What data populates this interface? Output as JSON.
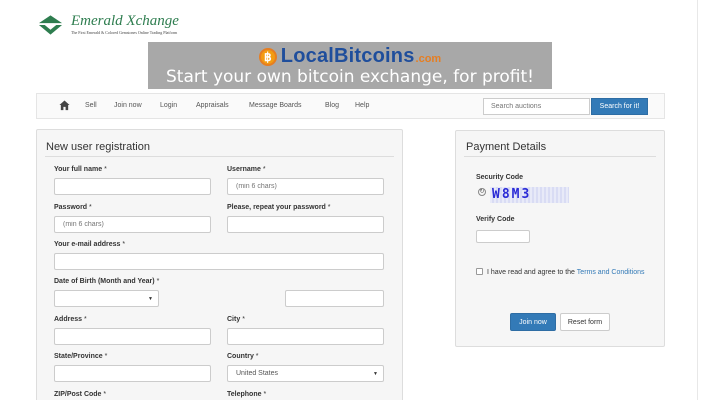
{
  "logo": {
    "title": "Emerald Xchange",
    "tagline": "The First Emerald & Colored Gemstones Online Trading Platform"
  },
  "banner": {
    "brand": "LocalBitcoins",
    "brand_suffix": ".com",
    "coin_symbol": "฿",
    "tagline": "Start your own bitcoin exchange, for profit!"
  },
  "nav": {
    "home_icon": "home-icon",
    "links": [
      "Sell",
      "Join now",
      "Login",
      "Appraisals",
      "Message Boards",
      "Blog",
      "Help"
    ],
    "search_placeholder": "Search auctions",
    "search_button": "Search for it!"
  },
  "registration": {
    "title": "New user registration",
    "full_name_label": "Your full name",
    "username_label": "Username",
    "username_placeholder": "(min 6 chars)",
    "password_label": "Password",
    "password_placeholder": "(min 6 chars)",
    "repeat_password_label": "Please, repeat your password",
    "email_label": "Your e-mail address",
    "dob_label": "Date of Birth (Month and Year)",
    "address_label": "Address",
    "city_label": "City",
    "state_label": "State/Province",
    "country_label": "Country",
    "country_value": "United States",
    "zip_label": "ZIP/Post Code",
    "telephone_label": "Telephone",
    "required_mark": "*"
  },
  "payment": {
    "title": "Payment Details",
    "security_code_label": "Security Code",
    "captcha_text": "W8M3",
    "verify_code_label": "Verify Code",
    "agree_text": "I have read and agree to the",
    "terms_link": "Terms and Conditions",
    "join_button": "Join now",
    "reset_button": "Reset form"
  },
  "colors": {
    "primary": "#337ab7",
    "brand_green": "#2e7d4f",
    "banner_bg": "#a8a8a8"
  }
}
